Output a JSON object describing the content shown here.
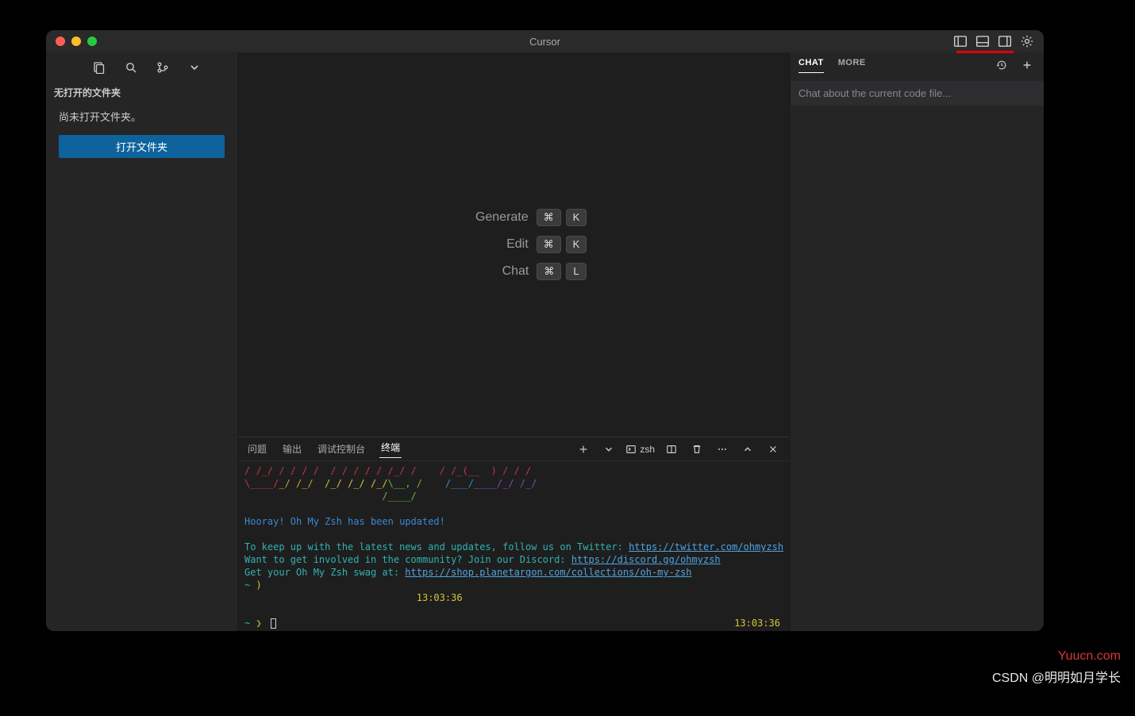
{
  "window": {
    "title": "Cursor"
  },
  "sidebar": {
    "section_title": "无打开的文件夹",
    "message": "尚未打开文件夹。",
    "open_button": "打开文件夹"
  },
  "shortcuts": [
    {
      "label": "Generate",
      "keys": [
        "⌘",
        "K"
      ]
    },
    {
      "label": "Edit",
      "keys": [
        "⌘",
        "K"
      ]
    },
    {
      "label": "Chat",
      "keys": [
        "⌘",
        "L"
      ]
    }
  ],
  "panel": {
    "tabs": [
      "问题",
      "输出",
      "调试控制台",
      "终端"
    ],
    "active_tab_index": 3,
    "shell_label": "zsh"
  },
  "terminal": {
    "ascii_line1": "/ /_/ / / / /  / / / / / /_/ /    / /_(__  ) / / /",
    "ascii_line2": "\\____/_/ /_/  /_/ /_/ /_/\\__, /    /___/____/_/ /_/",
    "ascii_line3": "                        /____/",
    "hooray": "Hooray! Oh My Zsh has been updated!",
    "twitter_pre": "To keep up with the latest news and updates, follow us on Twitter: ",
    "twitter_link": "https://twitter.com/ohmyzsh",
    "discord_pre": "Want to get involved in the community? Join our Discord: ",
    "discord_link": "https://discord.gg/ohmyzsh",
    "swag_pre": "Get your Oh My Zsh swag at: ",
    "swag_link": "https://shop.planetargon.com/collections/oh-my-zsh",
    "prompt1_tilde": "~",
    "prompt1_paren": ")",
    "time1": "13:03:36",
    "prompt2_tilde": "~",
    "prompt2_arrow": "❯",
    "time2": "13:03:36"
  },
  "chat": {
    "tabs": [
      "CHAT",
      "MORE"
    ],
    "active_index": 0,
    "placeholder": "Chat about the current code file..."
  },
  "watermarks": {
    "site": "Yuucn.com",
    "csdn": "CSDN @明明如月学长"
  }
}
